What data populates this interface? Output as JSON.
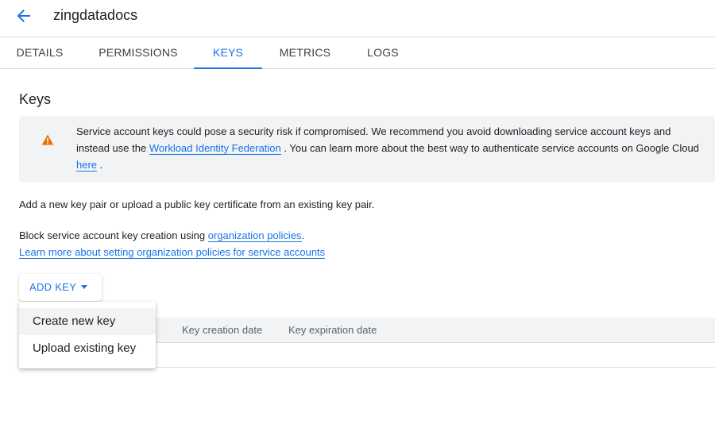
{
  "header": {
    "title": "zingdatadocs",
    "back_icon": "arrow-back-icon"
  },
  "tabs": [
    {
      "label": "DETAILS",
      "active": false
    },
    {
      "label": "PERMISSIONS",
      "active": false
    },
    {
      "label": "KEYS",
      "active": true
    },
    {
      "label": "METRICS",
      "active": false
    },
    {
      "label": "LOGS",
      "active": false
    }
  ],
  "section": {
    "title": "Keys"
  },
  "warning": {
    "icon": "warning-icon",
    "text_1": "Service account keys could pose a security risk if compromised. We recommend you avoid downloading service account keys and instead use the",
    "link_1": "Workload Identity Federation",
    "text_2": ". You can learn more about the best way to authenticate service accounts on Google Cloud",
    "link_2": "here",
    "text_3": "."
  },
  "intro": {
    "text": "Add a new key pair or upload a public key certificate from an existing key pair."
  },
  "policies": {
    "text": "Block service account key creation using",
    "link": "organization policies",
    "period": ".",
    "learn_more": "Learn more about setting organization policies for service accounts"
  },
  "add_key": {
    "label": "ADD KEY",
    "icon": "caret-down-icon"
  },
  "menu": {
    "items": [
      {
        "label": "Create new key",
        "hover": true
      },
      {
        "label": "Upload existing key",
        "hover": false
      }
    ]
  },
  "table": {
    "columns": [
      "Key creation date",
      "Key expiration date"
    ]
  },
  "colors": {
    "accent": "#1a73e8",
    "warning": "#e8710a",
    "surface": "#f1f3f4",
    "divider": "#dadce0"
  }
}
